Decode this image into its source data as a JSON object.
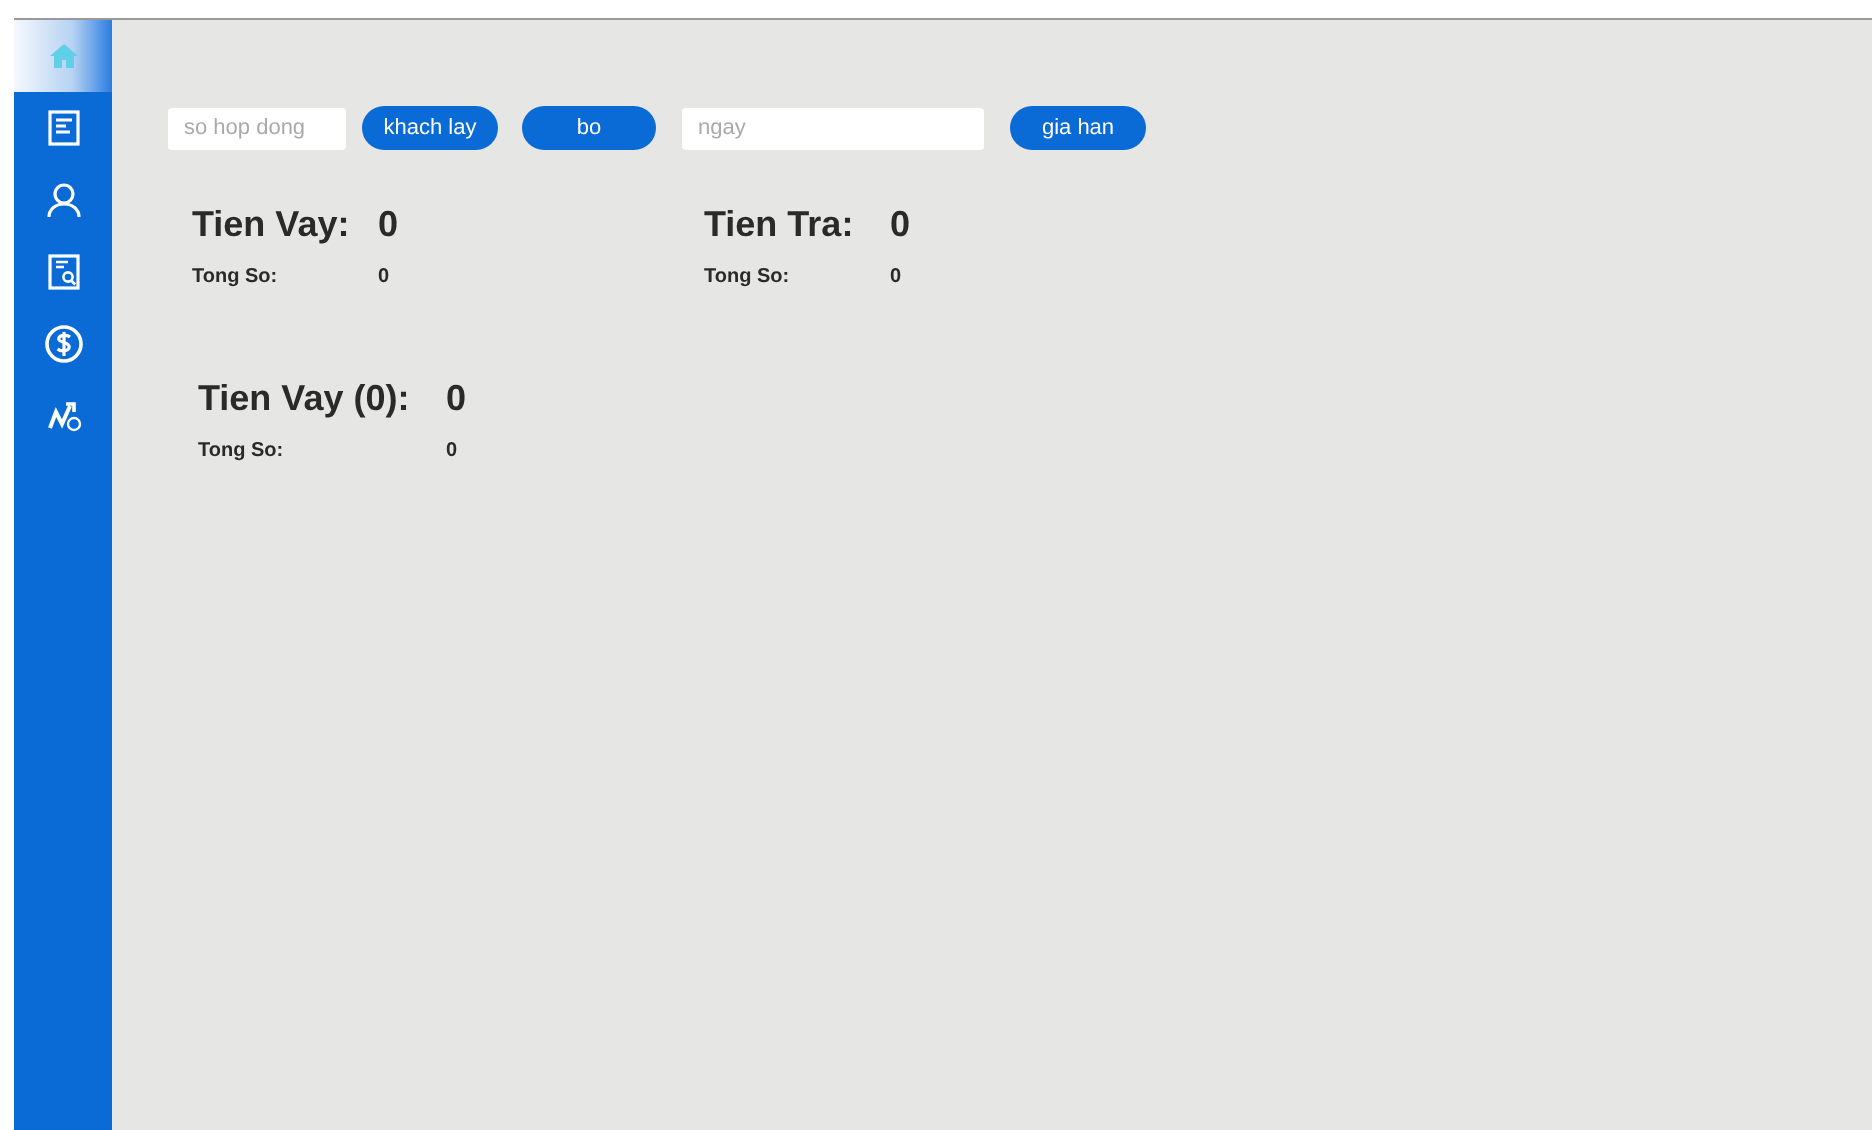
{
  "sidebar": {
    "items": [
      {
        "kind": "home",
        "selected": true
      },
      {
        "kind": "document",
        "selected": false
      },
      {
        "kind": "person",
        "selected": false
      },
      {
        "kind": "report",
        "selected": false
      },
      {
        "kind": "dollar",
        "selected": false
      },
      {
        "kind": "chart",
        "selected": false
      }
    ]
  },
  "toolbar": [
    {
      "kind": "field",
      "placeholder": "so hop dong"
    },
    {
      "kind": "button",
      "label": "khach lay"
    },
    {
      "kind": "button",
      "label": "bo"
    },
    {
      "kind": "field",
      "placeholder": "ngay"
    },
    {
      "kind": "button",
      "label": "gia han"
    }
  ],
  "summaries": [
    {
      "title": "Tien Vay:",
      "value": "0",
      "count_label": "Tong So:",
      "count": "0"
    },
    {
      "title": "Tien Tra:",
      "value": "0",
      "count_label": "Tong So:",
      "count": "0"
    },
    {
      "title": "Tien Vay (0):",
      "value": "0",
      "count_label": "Tong So:",
      "count": "0"
    }
  ]
}
